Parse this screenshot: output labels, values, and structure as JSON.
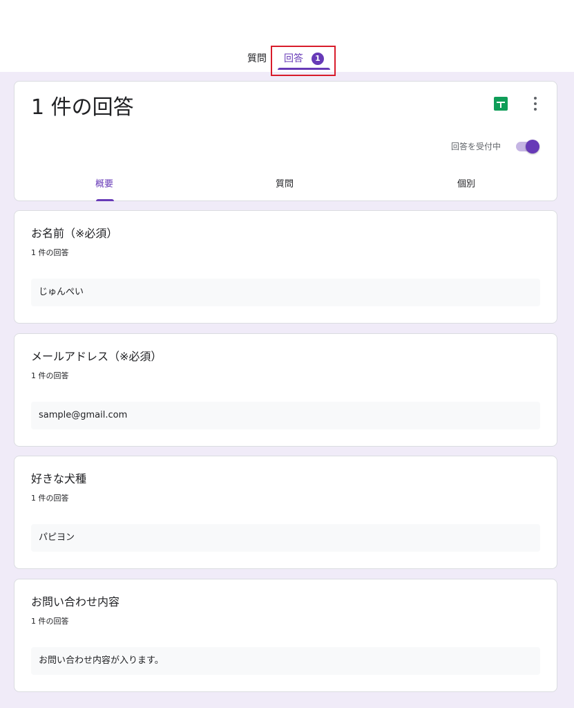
{
  "top_tabs": {
    "questions": "質問",
    "responses": "回答",
    "response_count": "1"
  },
  "summary": {
    "title": "1 件の回答",
    "accepting_label": "回答を受付中",
    "accepting": true,
    "tabs": {
      "summary": "概要",
      "question": "質問",
      "individual": "個別"
    }
  },
  "questions": [
    {
      "title": "お名前（※必須）",
      "count": "1 件の回答",
      "answer": "じゅんぺい"
    },
    {
      "title": "メールアドレス（※必須）",
      "count": "1 件の回答",
      "answer": "sample@gmail.com"
    },
    {
      "title": "好きな犬種",
      "count": "1 件の回答",
      "answer": "パピヨン"
    },
    {
      "title": "お問い合わせ内容",
      "count": "1 件の回答",
      "answer": "お問い合わせ内容が入ります。"
    }
  ],
  "colors": {
    "accent": "#673ab7",
    "page_background": "#f0ebf8",
    "sheets_green": "#0f9d58",
    "highlight_red": "#d81b2a"
  },
  "icons": {
    "sheets": "google-sheets-icon",
    "more": "more-vert-icon"
  }
}
